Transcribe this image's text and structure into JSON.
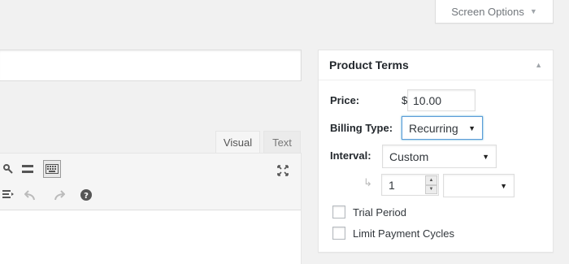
{
  "header": {
    "screen_options_label": "Screen Options",
    "screen_options_caret": "▼"
  },
  "editor": {
    "tabs": [
      {
        "label": "Visual",
        "active": true
      },
      {
        "label": "Text",
        "active": false
      }
    ],
    "toolbar_icons": [
      "unlink-icon",
      "read-more-icon",
      "toolbar-toggle-icon",
      "fullscreen-icon",
      "indent-icon",
      "undo-icon",
      "redo-icon",
      "help-icon"
    ]
  },
  "product_terms": {
    "title": "Product Terms",
    "toggle_caret": "▲",
    "price": {
      "label": "Price:",
      "currency": "$",
      "value": "10.00"
    },
    "billing_type": {
      "label": "Billing Type:",
      "selected": "Recurring"
    },
    "interval": {
      "label": "Interval:",
      "selected": "Custom"
    },
    "custom_interval": {
      "return_arrow": "↳",
      "count": "1",
      "unit": ""
    },
    "trial_period": {
      "label": "Trial Period",
      "checked": false
    },
    "limit_cycles": {
      "label": "Limit Payment Cycles",
      "checked": false
    }
  },
  "colors": {
    "background": "#f1f1f1",
    "panel": "#ffffff",
    "focus_border": "#5b9dd9"
  }
}
